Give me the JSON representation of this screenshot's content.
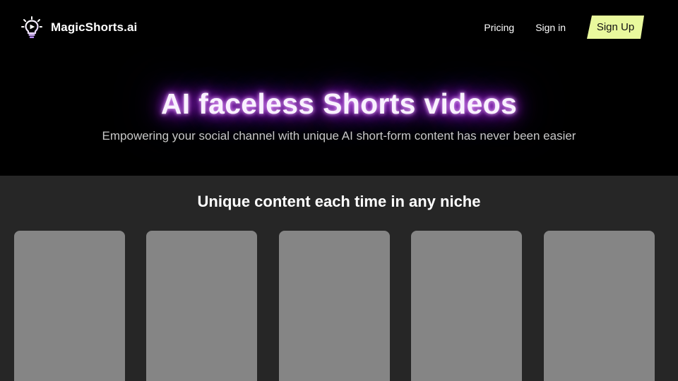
{
  "header": {
    "brand_name": "MagicShorts.ai",
    "logo_icon": "lightbulb-play-icon",
    "nav": {
      "pricing_label": "Pricing",
      "signin_label": "Sign in",
      "signup_label": "Sign Up"
    }
  },
  "hero": {
    "title": "AI faceless Shorts videos",
    "subtitle": "Empowering your social channel with unique AI short-form content has never been easier"
  },
  "gallery": {
    "title": "Unique content each time in any niche",
    "card_count": 5
  },
  "colors": {
    "background": "#000000",
    "section_background": "#262626",
    "card_placeholder": "#858585",
    "signup_button": "#e9f99d",
    "glow": "#b026ff"
  }
}
